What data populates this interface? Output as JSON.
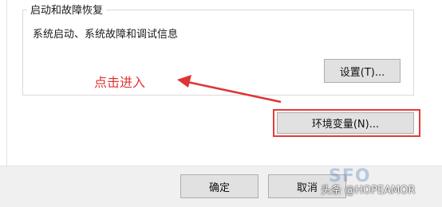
{
  "group": {
    "title": "启动和故障恢复",
    "description": "系统启动、系统故障和调试信息",
    "settings_button": "设置(T)..."
  },
  "env_button": "环境变量(N)...",
  "annotation": {
    "text": "点击进入",
    "color": "#e03333"
  },
  "footer": {
    "ok_button": "确定",
    "cancel_button": "取消"
  },
  "watermark": {
    "author": "头条 @HOPEAMOR",
    "logo_text": "SFO"
  },
  "colors": {
    "highlight": "#e23b3b",
    "button_face": "#e1e1e1"
  }
}
